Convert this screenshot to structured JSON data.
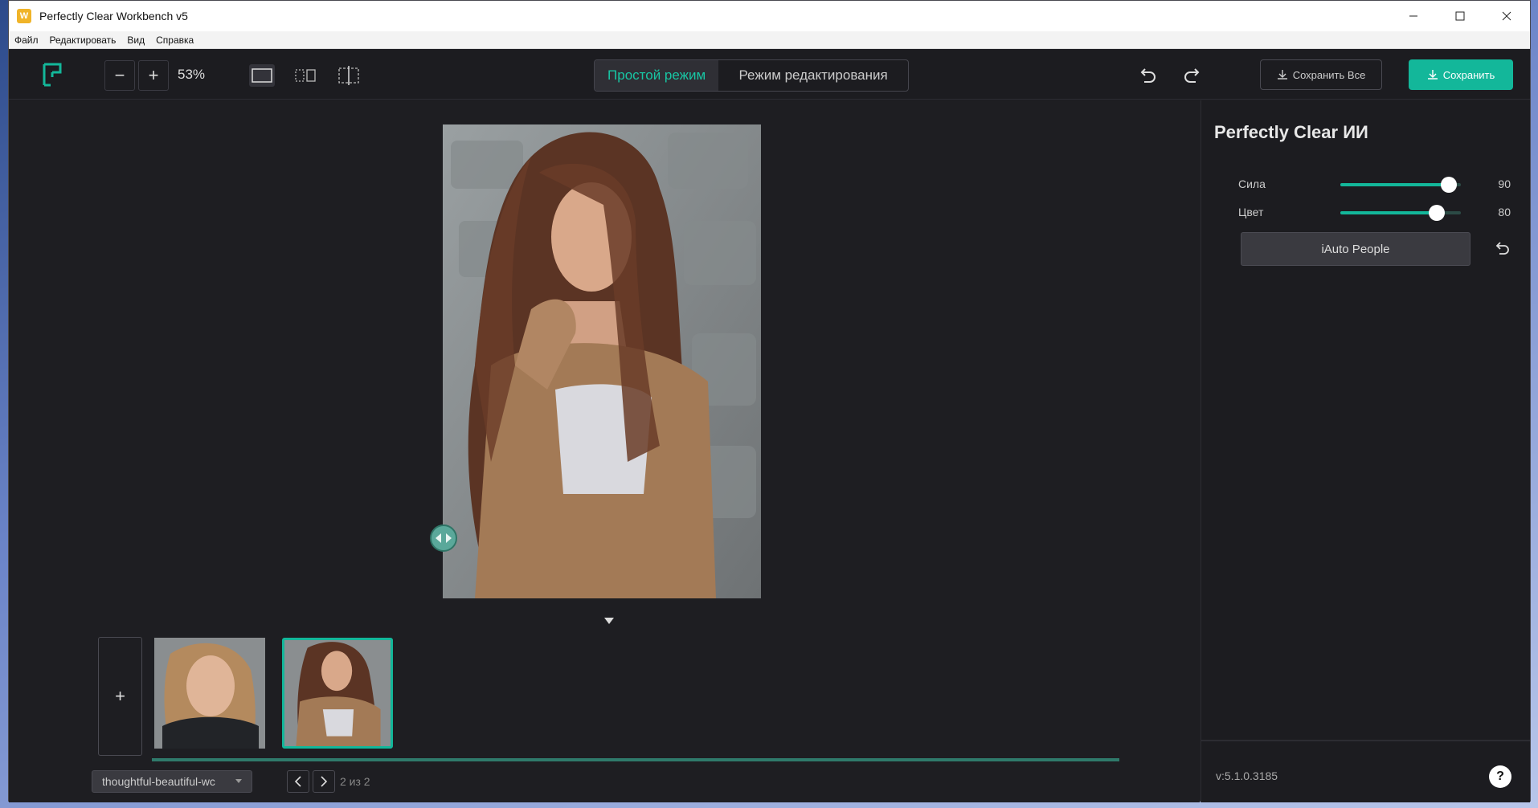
{
  "window": {
    "title": "Perfectly Clear Workbench v5",
    "app_icon_letter": "W"
  },
  "menu": [
    "Файл",
    "Редактировать",
    "Вид",
    "Справка"
  ],
  "toolbar": {
    "zoom_out": "−",
    "zoom_in": "+",
    "zoom_value": "53%",
    "mode_simple": "Простой режим",
    "mode_edit": "Режим редактирования",
    "save_all": "Сохранить Все",
    "save": "Сохранить"
  },
  "filmstrip": {
    "add_label": "+",
    "filename": "thoughtful-beautiful-wc",
    "pager": "2 из 2"
  },
  "panel": {
    "title": "Perfectly Clear ИИ",
    "sliders": [
      {
        "label": "Сила",
        "value": "90",
        "fraction": 0.9
      },
      {
        "label": "Цвет",
        "value": "80",
        "fraction": 0.8
      }
    ],
    "auto_button": "iAuto People",
    "version": "v:5.1.0.3185",
    "help": "?"
  },
  "colors": {
    "accent": "#13b79a",
    "background": "#1e1e22"
  }
}
